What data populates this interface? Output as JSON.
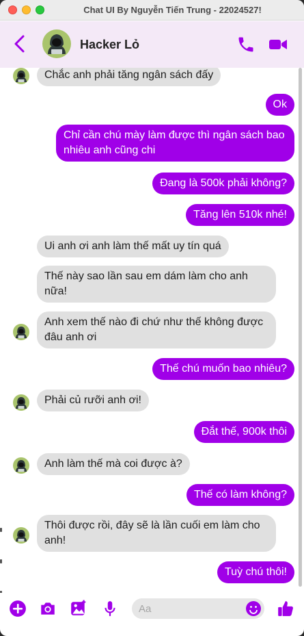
{
  "window": {
    "title": "Chat UI By Nguyễn Tiến Trung - 22024527!"
  },
  "header": {
    "contact_name": "Hacker Lỏ"
  },
  "colors": {
    "accent": "#a000e8",
    "incoming_bubble": "#e0e0e0",
    "header_bg": "#f4e9f7"
  },
  "messages": [
    {
      "side": "in",
      "text": "Chắc anh phải tăng ngân sách đấy",
      "avatar": true
    },
    {
      "side": "out",
      "text": "Ok"
    },
    {
      "side": "out",
      "text": "Chỉ cần chú mày làm được thì ngân sách bao nhiêu anh cũng chi"
    },
    {
      "side": "out",
      "text": "Đang là 500k phải không?"
    },
    {
      "side": "out",
      "text": "Tăng lên 510k nhé!"
    },
    {
      "side": "in",
      "text": "Ui anh ơi anh làm thế mất uy tín quá"
    },
    {
      "side": "in",
      "text": "Thế này sao lần sau em dám làm cho anh nữa!"
    },
    {
      "side": "in",
      "text": "Anh xem thế nào đi chứ như thế không được đâu anh ơi",
      "avatar": true
    },
    {
      "side": "out",
      "text": "Thế chú muốn bao nhiêu?"
    },
    {
      "side": "in",
      "text": "Phải củ rưỡi anh ơi!",
      "avatar": true
    },
    {
      "side": "out",
      "text": "Đắt thế, 900k thôi"
    },
    {
      "side": "in",
      "text": "Anh làm thế mà coi được à?",
      "avatar": true
    },
    {
      "side": "out",
      "text": "Thế có làm không?"
    },
    {
      "side": "in",
      "text": "Thôi được rồi, đây sẽ là lần cuối em làm cho anh!",
      "avatar": true
    },
    {
      "side": "out",
      "text": "Tuỳ chú thôi!"
    }
  ],
  "composer": {
    "placeholder": "Aa",
    "icons": [
      "add-icon",
      "camera-icon",
      "image-icon",
      "microphone-icon",
      "emoji-icon",
      "like-icon"
    ]
  }
}
